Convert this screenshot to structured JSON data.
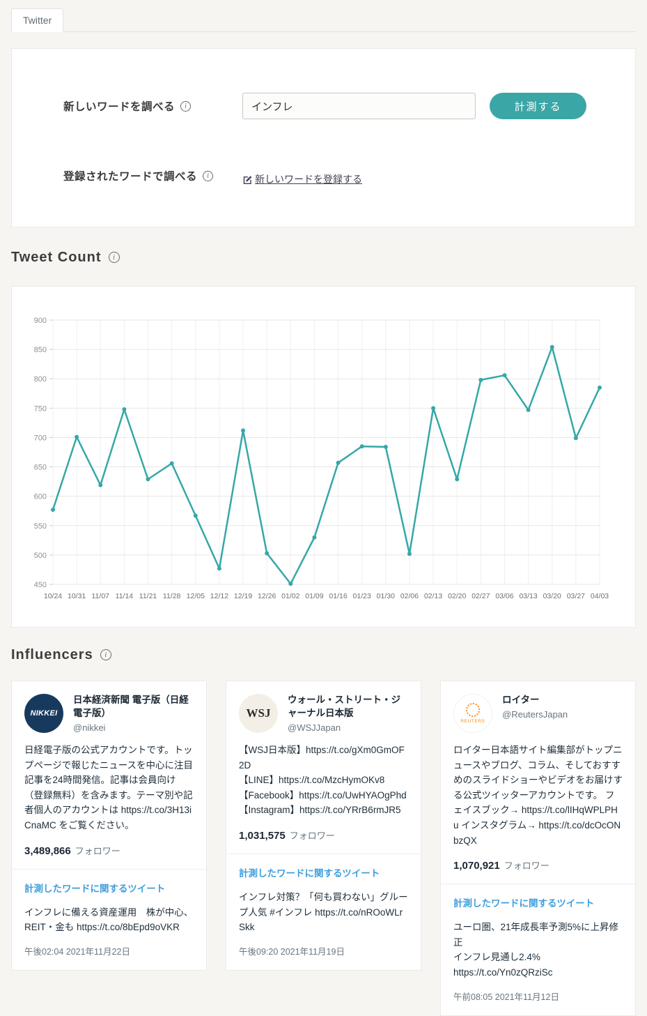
{
  "tab": {
    "label": "Twitter"
  },
  "search_panel": {
    "new_word_label": "新しいワードを調べる",
    "input_value": "インフレ",
    "measure_button_label": "計測する",
    "registered_word_label": "登録されたワードで調べる",
    "register_link_label": "新しいワードを登録する"
  },
  "tweet_count_section": {
    "title": "Tweet Count"
  },
  "influencers_section": {
    "title": "Influencers",
    "tweet_link_label": "計測したワードに関するツイート",
    "followers_suffix": "フォロワー",
    "cards": [
      {
        "avatar_text": "NIKKEI",
        "name": "日本経済新聞 電子版（日経電子版）",
        "handle": "@nikkei",
        "bio": "日経電子版の公式アカウントです。トップページで報じたニュースを中心に注目記事を24時間発信。記事は会員向け（登録無料）を含みます。テーマ別や記者個人のアカウントは https://t.co/3H13iCnaMC をご覧ください。",
        "followers": "3,489,866",
        "tweet": "インフレに備える資産運用　株が中心、REIT・金も https://t.co/8bEpd9oVKR",
        "time": "午後02:04 2021年11月22日"
      },
      {
        "avatar_text": "WSJ",
        "name": "ウォール・ストリート・ジャーナル日本版",
        "handle": "@WSJJapan",
        "bio": "【WSJ日本版】https://t.co/gXm0GmOF2D\n【LINE】https://t.co/MzcHymOKv8\n【Facebook】https://t.co/UwHYAOgPhd\n【Instagram】https://t.co/YRrB6rmJR5",
        "followers": "1,031,575",
        "tweet": "インフレ対策？「何も買わない」グループ人気 #インフレ https://t.co/nROoWLrSkk",
        "time": "午後09:20 2021年11月19日"
      },
      {
        "avatar_text": "REUTERS",
        "name": "ロイター",
        "handle": "@ReutersJapan",
        "bio": "ロイター日本語サイト編集部がトップニュースやブログ、コラム、そしておすすめのスライドショーやビデオをお届けする公式ツイッターアカウントです。 フェイスブック→ https://t.co/lIHqWPLPHu インスタグラム→ https://t.co/dcOcONbzQX",
        "followers": "1,070,921",
        "tweet": "ユーロ圏、21年成長率予測5%に上昇修正\nインフレ見通し2.4%\nhttps://t.co/Yn0zQRziSc",
        "time": "午前08:05 2021年11月12日"
      }
    ]
  },
  "chart_data": {
    "type": "line",
    "title": "Tweet Count",
    "x": [
      "10/24",
      "10/31",
      "11/07",
      "11/14",
      "11/21",
      "11/28",
      "12/05",
      "12/12",
      "12/19",
      "12/26",
      "01/02",
      "01/09",
      "01/16",
      "01/23",
      "01/30",
      "02/06",
      "02/13",
      "02/20",
      "02/27",
      "03/06",
      "03/13",
      "03/20",
      "03/27",
      "04/03"
    ],
    "values": [
      577,
      701,
      619,
      748,
      629,
      656,
      567,
      477,
      712,
      503,
      451,
      530,
      657,
      685,
      684,
      502,
      750,
      629,
      798,
      806,
      747,
      854,
      699,
      785
    ],
    "ylim": [
      450,
      900
    ],
    "ytick_step": 50,
    "line_color": "#36a7a7",
    "grid": true,
    "legend": "none"
  },
  "colors": {
    "accent_teal": "#3ba6a6",
    "link_blue": "#3e9ede",
    "nikkei_navy": "#17395d",
    "wsj_cream": "#f3efe6",
    "reuters_orange": "#f78e1e"
  }
}
